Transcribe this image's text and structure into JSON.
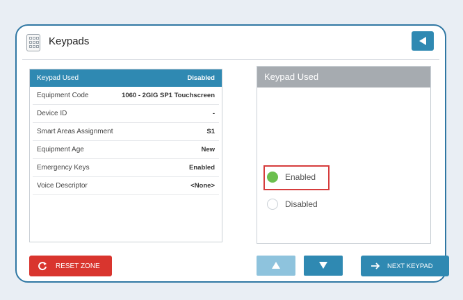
{
  "header": {
    "title": "Keypads",
    "icon": "keypad-icon",
    "back_icon": "back-arrow-icon"
  },
  "settings": {
    "rows": [
      {
        "label": "Keypad Used",
        "value": "Disabled",
        "selected": true
      },
      {
        "label": "Equipment Code",
        "value": "1060 - 2GIG SP1 Touchscreen"
      },
      {
        "label": "Device ID",
        "value": "-"
      },
      {
        "label": "Smart Areas Assignment",
        "value": "S1"
      },
      {
        "label": "Equipment Age",
        "value": "New"
      },
      {
        "label": "Emergency Keys",
        "value": "Enabled"
      },
      {
        "label": "Voice Descriptor",
        "value": "<None>"
      }
    ]
  },
  "detail": {
    "title": "Keypad Used",
    "options": [
      {
        "label": "Enabled",
        "checked": true
      },
      {
        "label": "Disabled",
        "checked": false
      }
    ]
  },
  "footer": {
    "reset_label": "RESET ZONE",
    "next_label": "NEXT KEYPAD",
    "up_icon": "up-arrow-icon",
    "down_icon": "down-arrow-icon"
  },
  "colors": {
    "accent": "#2f89b2",
    "reset": "#d9352e",
    "enabled": "#6bbf4e",
    "highlight": "#d63c3c"
  }
}
